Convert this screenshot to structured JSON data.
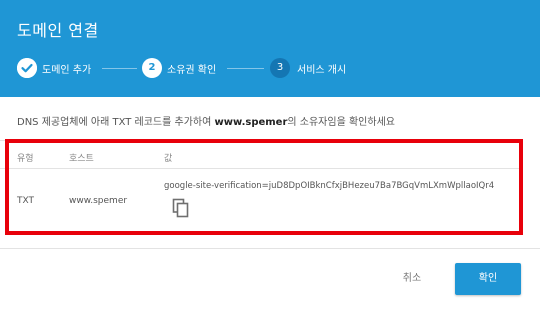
{
  "dialog": {
    "title": "도메인 연결",
    "steps": [
      {
        "number": "✓",
        "label": "도메인 추가",
        "state": "done"
      },
      {
        "number": "2",
        "label": "소유권 확인",
        "state": "active"
      },
      {
        "number": "3",
        "label": "서비스 개시",
        "state": "pending"
      }
    ],
    "description": {
      "before": "DNS 제공업체에 아래 TXT 레코드를 추가하여 ",
      "domain": "www.spemer",
      "after": "의 소유자임을 확인하세요"
    },
    "table": {
      "headers": {
        "type": "유형",
        "host": "호스트",
        "value": "값"
      },
      "row": {
        "type": "TXT",
        "host": "www.spemer",
        "value": "google-site-verification=juD8DpOIBknCfxjBHezeu7Ba7BGqVmLXmWpllaoIQr4"
      }
    },
    "buttons": {
      "cancel": "취소",
      "confirm": "확인"
    },
    "colors": {
      "header": "#1f96d5",
      "highlight": "#e8000a"
    }
  }
}
